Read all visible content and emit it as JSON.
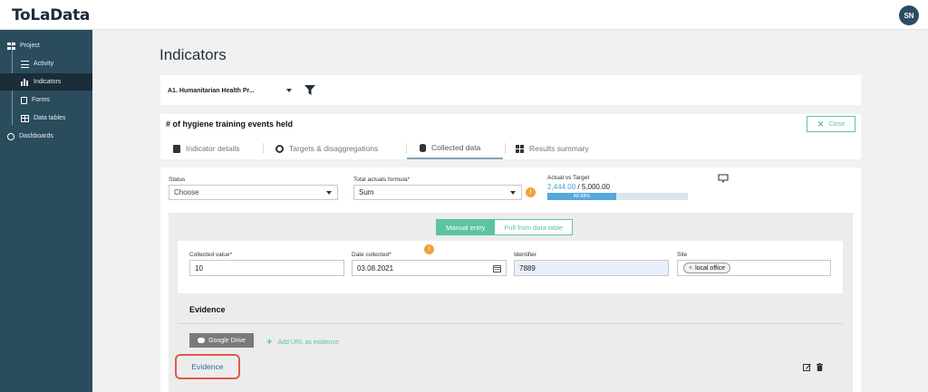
{
  "app": {
    "logo": "ToLaData",
    "avatar_initials": "SN"
  },
  "sidebar": {
    "items": [
      {
        "label": "Project",
        "icon": "grid-icon",
        "level": "top",
        "active": false
      },
      {
        "label": "Activity",
        "icon": "list-icon",
        "level": "sub",
        "active": false
      },
      {
        "label": "Indicators",
        "icon": "bar-chart-icon",
        "level": "sub",
        "active": true
      },
      {
        "label": "Forms",
        "icon": "form-icon",
        "level": "sub",
        "active": false
      },
      {
        "label": "Data tables",
        "icon": "table-icon",
        "level": "sub",
        "active": false
      },
      {
        "label": "Dashboards",
        "icon": "dashboard-icon",
        "level": "top",
        "active": false
      }
    ]
  },
  "page": {
    "title": "Indicators"
  },
  "filter": {
    "indicator_select": "A1. Humanitarian Health Pr..."
  },
  "indicator": {
    "name": "# of hygiene training events held",
    "close_label": "Close",
    "tabs": [
      {
        "label": "Indicator details",
        "icon": "clipboard-icon",
        "active": false
      },
      {
        "label": "Targets & disaggregations",
        "icon": "target-icon",
        "active": false
      },
      {
        "label": "Collected data",
        "icon": "database-icon",
        "active": true
      },
      {
        "label": "Results summary",
        "icon": "tiles-icon",
        "active": false
      }
    ]
  },
  "collected": {
    "status_label": "Status",
    "status_value": "Choose",
    "formula_label": "Total actuals formula*",
    "formula_value": "Sum",
    "formula_badge": "!",
    "avt_label": "Actual vs Target",
    "actual": "2,444.00",
    "target": "/ 5,000.00",
    "progress_percent": 48.88,
    "progress_text": "48.88%",
    "colors": {
      "accent": "#5cc4a1",
      "progress": "#56a8dc",
      "warning": "#f0a23a",
      "highlight": "#e05a4b"
    }
  },
  "entry": {
    "mode_manual": "Manual entry",
    "mode_pull": "Pull from data table",
    "collected_value_label": "Collected value*",
    "collected_value": "10",
    "date_label": "Date collected*",
    "date_badge": "!",
    "date_value": "03.08.2021",
    "identifier_label": "Identifier",
    "identifier_value": "7889",
    "site_label": "Site",
    "site_chip": "local office"
  },
  "evidence": {
    "title": "Evidence",
    "google_drive": "Google Drive",
    "add_url": "Add URL as evidence",
    "link_label": "Evidence"
  }
}
